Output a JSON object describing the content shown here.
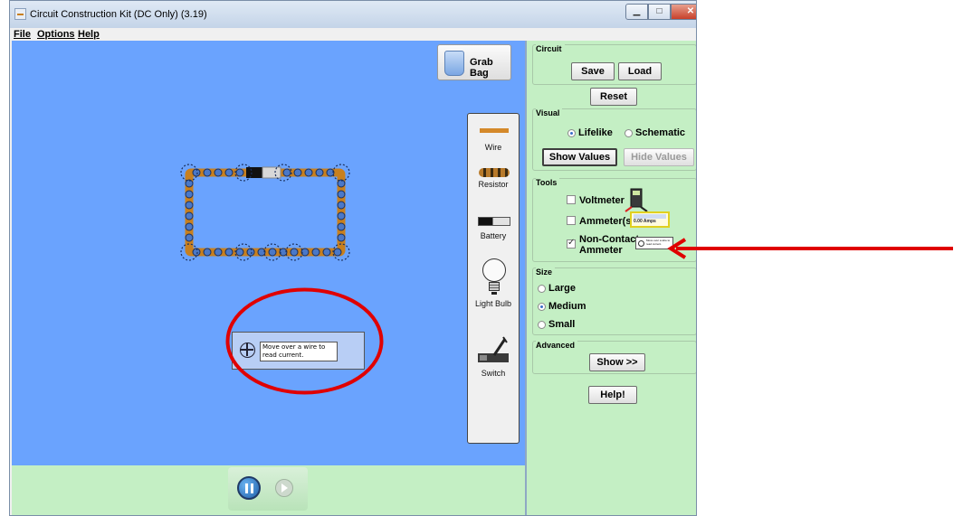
{
  "window": {
    "title": "Circuit Construction Kit (DC Only) (3.19)"
  },
  "menu": {
    "file": "File",
    "options": "Options",
    "help": "Help"
  },
  "canvas": {
    "grab_bag_label": "Grab Bag",
    "non_contact_ammeter_text": "Move over a wire to read current."
  },
  "toolbox": {
    "wire": "Wire",
    "resistor": "Resistor",
    "battery": "Battery",
    "light_bulb": "Light Bulb",
    "switch": "Switch"
  },
  "panel": {
    "circuit": {
      "title": "Circuit",
      "save": "Save",
      "load": "Load",
      "reset": "Reset"
    },
    "visual": {
      "title": "Visual",
      "lifelike": "Lifelike",
      "schematic": "Schematic",
      "selected": "Lifelike",
      "show_values": "Show Values",
      "hide_values": "Hide Values"
    },
    "tools": {
      "title": "Tools",
      "voltmeter": "Voltmeter",
      "ammeters": "Ammeter(s)",
      "non_contact_line1": "Non-Contact",
      "non_contact_line2": "Ammeter",
      "ammeter_readout": "0.00 Amps",
      "nca_thumb_text": "Move over a wire to read current.",
      "voltmeter_checked": false,
      "ammeters_checked": false,
      "non_contact_checked": true
    },
    "size": {
      "title": "Size",
      "large": "Large",
      "medium": "Medium",
      "small": "Small",
      "selected": "Medium"
    },
    "advanced": {
      "title": "Advanced",
      "show": "Show >>"
    },
    "help": "Help!"
  },
  "colors": {
    "canvas_blue": "#6aa3fe",
    "panel_green": "#c4efc4",
    "wire_orange": "#c8801f",
    "annotation_red": "#e00000"
  }
}
